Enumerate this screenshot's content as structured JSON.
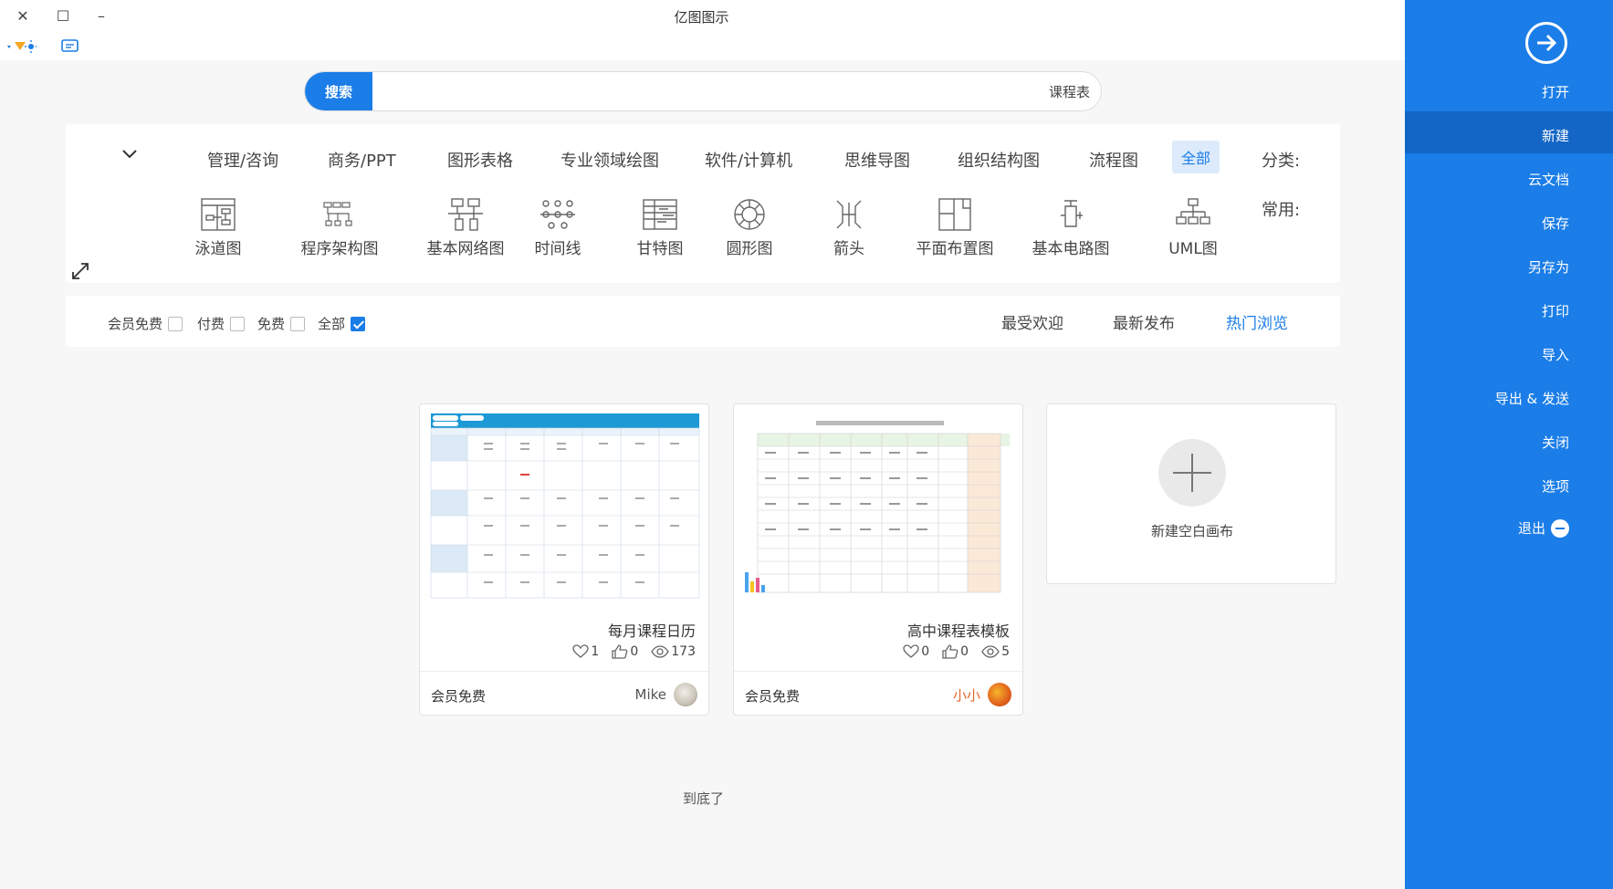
{
  "window": {
    "title": "亿图图示",
    "close": "✕",
    "maximize": "☐",
    "minimize": "–"
  },
  "sidebar": {
    "items": [
      {
        "label": "打开"
      },
      {
        "label": "新建"
      },
      {
        "label": "云文档"
      },
      {
        "label": "保存"
      },
      {
        "label": "另存为"
      },
      {
        "label": "打印"
      },
      {
        "label": "导入"
      },
      {
        "label": "导出 & 发送"
      },
      {
        "label": "关闭"
      },
      {
        "label": "选项"
      },
      {
        "label": "退出"
      }
    ],
    "active": "新建"
  },
  "search": {
    "button": "搜索",
    "value": "课程表"
  },
  "categories": {
    "label": "分类:",
    "items": [
      "全部",
      "流程图",
      "组织结构图",
      "思维导图",
      "软件/计算机",
      "专业领域绘图",
      "图形表格",
      "商务/PPT",
      "管理/咨询"
    ],
    "active": "全部"
  },
  "common": {
    "label": "常用:",
    "items": [
      "UML图",
      "基本电路图",
      "平面布置图",
      "箭头",
      "圆形图",
      "甘特图",
      "时间线",
      "基本网络图",
      "程序架构图",
      "泳道图"
    ]
  },
  "sort_tabs": {
    "items": [
      "热门浏览",
      "最新发布",
      "最受欢迎"
    ],
    "active": "热门浏览"
  },
  "filters": {
    "items": [
      {
        "label": "全部",
        "checked": true
      },
      {
        "label": "免费",
        "checked": false
      },
      {
        "label": "付费",
        "checked": false
      },
      {
        "label": "会员免费",
        "checked": false
      }
    ]
  },
  "new_blank": {
    "label": "新建空白画布"
  },
  "templates": [
    {
      "title": "高中课程表模板",
      "views": "5",
      "likes": "0",
      "favorites": "0",
      "author": "小小",
      "price": "会员免费",
      "author_color": "#e8632a"
    },
    {
      "title": "每月课程日历",
      "views": "173",
      "likes": "0",
      "favorites": "1",
      "author": "Mike",
      "price": "会员免费",
      "author_color": "#555555"
    }
  ],
  "end_text": "到底了",
  "colors": {
    "accent": "#1b7de7",
    "sidebar": "#1b7de7",
    "sidebar_active": "#1466c6"
  }
}
